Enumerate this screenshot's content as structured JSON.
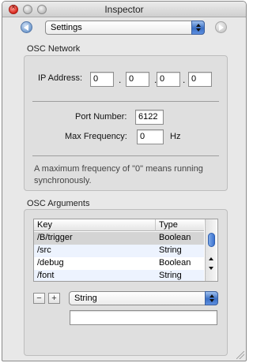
{
  "window": {
    "title": "Inspector"
  },
  "toolbar": {
    "selected": "Settings"
  },
  "osc_network": {
    "label": "OSC Network",
    "ip_label": "IP Address:",
    "ip": [
      "0",
      "0",
      "0",
      "0"
    ],
    "ip_separator": ".",
    "port_label": "Port Number:",
    "port_value": "6122",
    "freq_label": "Max Frequency:",
    "freq_value": "0",
    "freq_unit": "Hz",
    "note": "A maximum frequency of \"0\" means running synchronously."
  },
  "osc_arguments": {
    "label": "OSC Arguments",
    "columns": [
      "Key",
      "Type"
    ],
    "rows": [
      {
        "key": "/B/trigger",
        "type": "Boolean"
      },
      {
        "key": "/src",
        "type": "String"
      },
      {
        "key": "/debug",
        "type": "Boolean"
      },
      {
        "key": "/font",
        "type": "String"
      }
    ],
    "remove_label": "−",
    "add_label": "+",
    "type_selected": "String",
    "value_field": ""
  }
}
